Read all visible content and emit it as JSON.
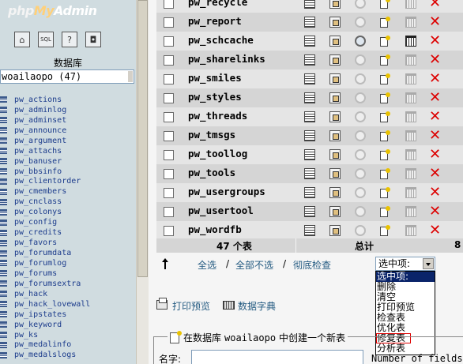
{
  "nav": {
    "logo": {
      "php": "php",
      "my": "My",
      "admin": "Admin"
    },
    "quicklinks": [
      {
        "name": "home-icon",
        "glyph": "⌂"
      },
      {
        "name": "sql-icon",
        "glyph": "SQL"
      },
      {
        "name": "help-icon",
        "glyph": "?"
      },
      {
        "name": "query-window-icon",
        "glyph": "◘"
      }
    ],
    "db_label": "数据库",
    "db_select": "woailaopo (47)",
    "tables": [
      "pw_actions",
      "pw_adminlog",
      "pw_adminset",
      "pw_announce",
      "pw_argument",
      "pw_attachs",
      "pw_banuser",
      "pw_bbsinfo",
      "pw_clientorder",
      "pw_cmembers",
      "pw_cnclass",
      "pw_colonys",
      "pw_config",
      "pw_credits",
      "pw_favors",
      "pw_forumdata",
      "pw_forumlog",
      "pw_forums",
      "pw_forumsextra",
      "pw_hack",
      "pw_hack_lovewall",
      "pw_ipstates",
      "pw_keyword",
      "pw_ks",
      "pw_medalinfo",
      "pw_medalslogs"
    ]
  },
  "main": {
    "rows": [
      {
        "name": "pw_recycle",
        "empty": true
      },
      {
        "name": "pw_report",
        "empty": true
      },
      {
        "name": "pw_schcache",
        "empty": false
      },
      {
        "name": "pw_sharelinks",
        "empty": true
      },
      {
        "name": "pw_smiles",
        "empty": true
      },
      {
        "name": "pw_styles",
        "empty": true
      },
      {
        "name": "pw_threads",
        "empty": true
      },
      {
        "name": "pw_tmsgs",
        "empty": true
      },
      {
        "name": "pw_toollog",
        "empty": true
      },
      {
        "name": "pw_tools",
        "empty": true
      },
      {
        "name": "pw_usergroups",
        "empty": true
      },
      {
        "name": "pw_usertool",
        "empty": true
      },
      {
        "name": "pw_wordfb",
        "empty": true
      }
    ],
    "summary": {
      "count": "47 个表",
      "total_label": "总计",
      "size": "8"
    },
    "check": {
      "all": "全选",
      "sep1": "/",
      "none": "全部不选",
      "sep2": "/",
      "overhead": "彻底检查"
    },
    "with_selected": {
      "value": "选中项:",
      "options": [
        "选中项:",
        "删除",
        "清空",
        "打印预览",
        "检查表",
        "优化表",
        "修复表",
        "分析表"
      ]
    },
    "print_view": "打印预览",
    "data_dict": "数据字典",
    "create": {
      "prefix": "在数据库",
      "db": "woailaopo",
      "suffix": "中创建一个新表",
      "name_label": "名字:",
      "fields_label": "Number of fields:"
    }
  }
}
